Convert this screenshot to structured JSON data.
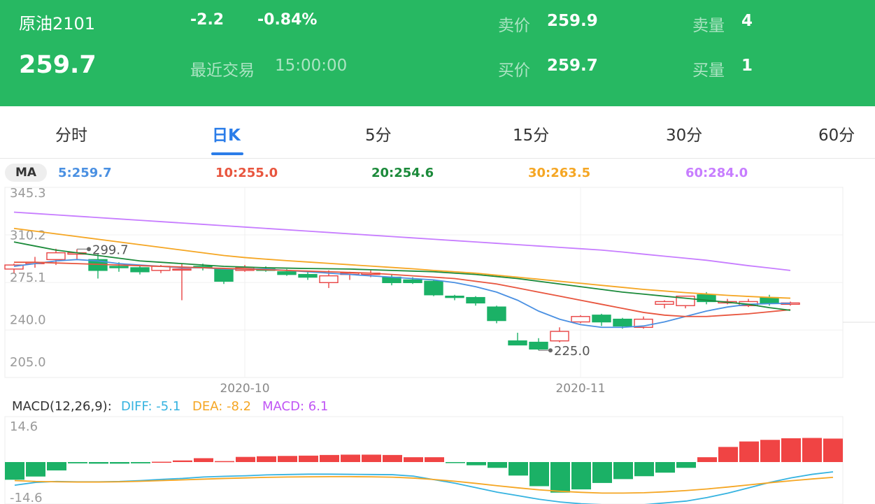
{
  "header": {
    "name": "原油2101",
    "last_price": "259.7",
    "change": "-2.2",
    "change_pct": "-0.84%",
    "last_trade_label": "最近交易",
    "last_trade_time": "15:00:00",
    "ask_label": "卖价",
    "ask_price": "259.9",
    "ask_vol_label": "卖量",
    "ask_vol": "4",
    "bid_label": "买价",
    "bid_price": "259.7",
    "bid_vol_label": "买量",
    "bid_vol": "1",
    "bg_color": "#27b862"
  },
  "tabs": [
    {
      "label": "分时"
    },
    {
      "label": "日K",
      "active": true
    },
    {
      "label": "5分"
    },
    {
      "label": "15分"
    },
    {
      "label": "30分"
    },
    {
      "label": "60分"
    }
  ],
  "ma": {
    "badge": "MA",
    "items": [
      {
        "label": "5:259.7",
        "color": "#4a90e2"
      },
      {
        "label": "10:255.0",
        "color": "#e8553e"
      },
      {
        "label": "20:254.6",
        "color": "#1b8a3a"
      },
      {
        "label": "30:263.5",
        "color": "#f5a623"
      },
      {
        "label": "60:284.0",
        "color": "#c77dff"
      }
    ]
  },
  "macd": {
    "title": "MACD(12,26,9):",
    "diff": "DIFF:  -5.1",
    "dea": "DEA:  -8.2",
    "macd": "MACD:  6.1",
    "colors": {
      "title": "#333333",
      "diff": "#36b3e0",
      "dea": "#f5a623",
      "macd": "#c055f5"
    }
  },
  "chart_data": [
    {
      "type": "candlestick",
      "title": "日K",
      "ylim": [
        205.0,
        345.3
      ],
      "y_ticks": [
        "345.3",
        "310.2",
        "275.1",
        "240.0",
        "205.0"
      ],
      "x_ticks": [
        "2020-10",
        "2020-11"
      ],
      "x_tick_index": [
        11,
        27
      ],
      "colors": {
        "up": "#e84444",
        "down": "#1bb166"
      },
      "candles": [
        {
          "o": 285,
          "h": 289,
          "l": 282,
          "c": 288
        },
        {
          "o": 289,
          "h": 294,
          "l": 286,
          "c": 290
        },
        {
          "o": 292,
          "h": 300,
          "l": 288,
          "c": 297
        },
        {
          "o": 296,
          "h": 299.7,
          "l": 292,
          "c": 297
        },
        {
          "o": 292,
          "h": 296,
          "l": 278,
          "c": 284
        },
        {
          "o": 287,
          "h": 290,
          "l": 283,
          "c": 286
        },
        {
          "o": 286,
          "h": 288,
          "l": 281,
          "c": 283
        },
        {
          "o": 284,
          "h": 288,
          "l": 282,
          "c": 287
        },
        {
          "o": 285,
          "h": 289,
          "l": 262,
          "c": 285
        },
        {
          "o": 287,
          "h": 289,
          "l": 284,
          "c": 286
        },
        {
          "o": 285,
          "h": 286,
          "l": 274,
          "c": 276
        },
        {
          "o": 284,
          "h": 288,
          "l": 283,
          "c": 286
        },
        {
          "o": 285,
          "h": 287,
          "l": 283,
          "c": 284
        },
        {
          "o": 283,
          "h": 285,
          "l": 280,
          "c": 281
        },
        {
          "o": 281,
          "h": 283,
          "l": 277,
          "c": 279
        },
        {
          "o": 275,
          "h": 284,
          "l": 271,
          "c": 280
        },
        {
          "o": 281,
          "h": 283,
          "l": 277,
          "c": 282
        },
        {
          "o": 281,
          "h": 284,
          "l": 279,
          "c": 282
        },
        {
          "o": 279,
          "h": 281,
          "l": 273,
          "c": 275
        },
        {
          "o": 277,
          "h": 279,
          "l": 274,
          "c": 275
        },
        {
          "o": 276,
          "h": 277,
          "l": 265,
          "c": 266
        },
        {
          "o": 265,
          "h": 266,
          "l": 262,
          "c": 264
        },
        {
          "o": 264,
          "h": 265,
          "l": 258,
          "c": 260
        },
        {
          "o": 257,
          "h": 258,
          "l": 245,
          "c": 247
        },
        {
          "o": 232,
          "h": 238,
          "l": 229,
          "c": 229
        },
        {
          "o": 231,
          "h": 234,
          "l": 225.0,
          "c": 226
        },
        {
          "o": 232,
          "h": 242,
          "l": 231,
          "c": 239
        },
        {
          "o": 246,
          "h": 251,
          "l": 245,
          "c": 250
        },
        {
          "o": 251,
          "h": 252,
          "l": 243,
          "c": 246
        },
        {
          "o": 248,
          "h": 249,
          "l": 241,
          "c": 243
        },
        {
          "o": 242,
          "h": 250,
          "l": 241,
          "c": 248
        },
        {
          "o": 259,
          "h": 262,
          "l": 256,
          "c": 261
        },
        {
          "o": 258,
          "h": 264,
          "l": 256,
          "c": 265
        },
        {
          "o": 266,
          "h": 268,
          "l": 259,
          "c": 261
        },
        {
          "o": 260,
          "h": 263,
          "l": 259,
          "c": 261
        },
        {
          "o": 258,
          "h": 263,
          "l": 257,
          "c": 261
        },
        {
          "o": 264,
          "h": 266,
          "l": 258,
          "c": 260
        },
        {
          "o": 259,
          "h": 261,
          "l": 258,
          "c": 260
        }
      ],
      "annotations": [
        {
          "label": "299.7",
          "index": 3,
          "value": 299.7
        },
        {
          "label": "225.0",
          "index": 25,
          "value": 225.0
        }
      ],
      "series": [
        {
          "name": "5",
          "color": "#4a90e2",
          "values": [
            287,
            289,
            291,
            292,
            291,
            289,
            288,
            287,
            286,
            286,
            285,
            285,
            285,
            284,
            283,
            282,
            281,
            280,
            279,
            278,
            277,
            275,
            272,
            268,
            262,
            254,
            248,
            244,
            242,
            242,
            243,
            246,
            250,
            254,
            257,
            259,
            259.5,
            259.7
          ]
        },
        {
          "name": "10",
          "color": "#e8553e",
          "values": [
            290,
            290,
            289.5,
            289,
            288.5,
            288,
            287.5,
            287,
            286.5,
            286,
            285.5,
            285,
            284.5,
            284,
            283.5,
            283,
            282.5,
            282,
            281,
            280,
            279,
            278,
            276,
            274,
            271,
            268,
            265,
            262,
            259,
            256,
            253,
            251,
            250,
            250,
            251,
            252,
            253.5,
            255.0
          ]
        },
        {
          "name": "20",
          "color": "#1b8a3a",
          "values": [
            305,
            302,
            299,
            297,
            295,
            293,
            291,
            290,
            289,
            288,
            287,
            286.5,
            286,
            285.7,
            285.4,
            285.2,
            285,
            284.5,
            284,
            283.5,
            283,
            282,
            281,
            279.5,
            278,
            276,
            274,
            272,
            270,
            268,
            266.5,
            265,
            263.5,
            262,
            260.5,
            259,
            256.5,
            254.6
          ]
        },
        {
          "name": "30",
          "color": "#f5a623",
          "values": [
            315,
            313,
            311,
            309,
            307,
            305,
            303,
            301,
            299,
            297,
            295,
            293.5,
            292.3,
            291.2,
            290.2,
            289.2,
            288.2,
            287.2,
            286.2,
            285.2,
            284,
            283,
            282,
            280.5,
            279,
            277.5,
            276,
            274.5,
            273,
            271.5,
            270,
            268.8,
            267.6,
            266.6,
            265.6,
            264.8,
            264.1,
            263.5
          ]
        },
        {
          "name": "60",
          "color": "#c77dff",
          "values": [
            327,
            326,
            325,
            324,
            323,
            322,
            321,
            320,
            319,
            318,
            317,
            316,
            315,
            314,
            313,
            312,
            311,
            310,
            309,
            308,
            307,
            306,
            305,
            304,
            303,
            302,
            301,
            300,
            299,
            297.6,
            296,
            294.5,
            293,
            291.5,
            289.5,
            287.5,
            285.8,
            284.0
          ]
        }
      ]
    },
    {
      "type": "bar",
      "title": "MACD(12,26,9)",
      "ylim": [
        -14.6,
        14.6
      ],
      "y_ticks": [
        "14.6",
        "0",
        "-14.6"
      ],
      "colors": {
        "positive": "#f04444",
        "negative": "#1bb166"
      },
      "values": [
        -5.5,
        -4.5,
        -2.6,
        -0.4,
        -0.5,
        -0.5,
        -0.4,
        0.1,
        0.5,
        1.2,
        0.3,
        1.6,
        1.8,
        1.9,
        2.0,
        2.2,
        2.3,
        2.3,
        2.2,
        1.5,
        1.5,
        -0.3,
        -1.0,
        -1.8,
        -4.2,
        -7.5,
        -9.5,
        -8.5,
        -6.5,
        -5.3,
        -4.4,
        -3.3,
        -1.8,
        1.5,
        4.7,
        6.4,
        6.9,
        7.4,
        7.5,
        7.3
      ],
      "series": [
        {
          "name": "DIFF",
          "color": "#36b3e0",
          "values": [
            -12.6,
            -11.0,
            -10.5,
            -10.7,
            -10.7,
            -10.5,
            -10.0,
            -9.3,
            -8.8,
            -8.0,
            -7.6,
            -7.3,
            -6.8,
            -6.6,
            -6.4,
            -6.4,
            -6.5,
            -6.6,
            -6.7,
            -7.5,
            -9.5,
            -11.5,
            -14.0,
            -16.5,
            -18.5,
            -20.5,
            -22.0,
            -23.0,
            -23.5,
            -23.8,
            -23.5,
            -22.5,
            -21.5,
            -19.5,
            -17.0,
            -14.0,
            -11.0,
            -8.5,
            -6.5,
            -5.1
          ]
        },
        {
          "name": "DEA",
          "color": "#f5a623",
          "values": [
            -10.0,
            -10.5,
            -10.7,
            -10.8,
            -10.8,
            -10.7,
            -10.4,
            -10.0,
            -9.6,
            -9.2,
            -8.8,
            -8.5,
            -8.2,
            -8.0,
            -7.9,
            -7.8,
            -7.8,
            -7.9,
            -8.1,
            -8.6,
            -9.4,
            -10.4,
            -11.6,
            -12.9,
            -14.1,
            -15.2,
            -16.0,
            -16.6,
            -17.0,
            -17.0,
            -16.8,
            -16.3,
            -15.6,
            -14.7,
            -13.6,
            -12.4,
            -11.2,
            -10.1,
            -9.1,
            -8.2
          ]
        }
      ]
    }
  ]
}
